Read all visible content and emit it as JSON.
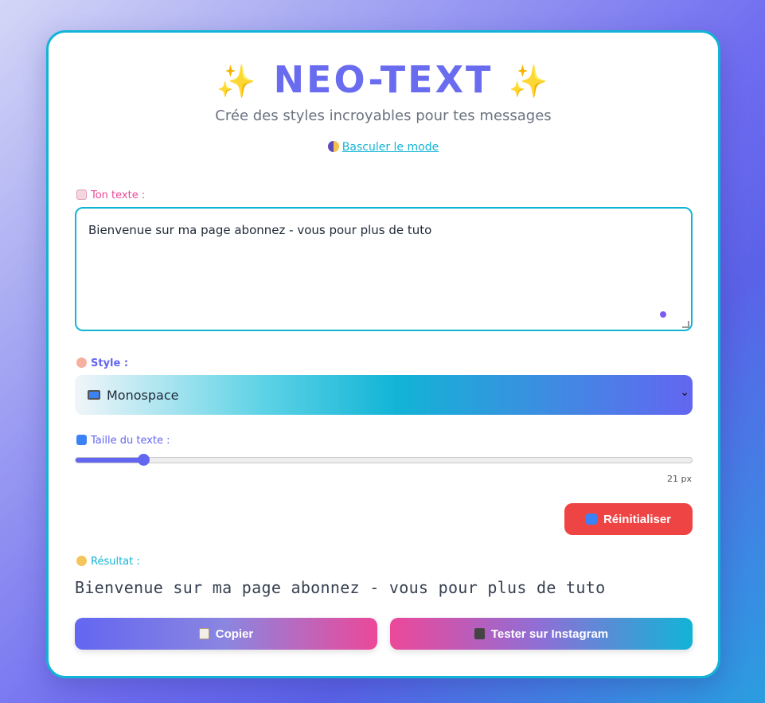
{
  "header": {
    "title": "NEO-TEXT",
    "subtitle": "Crée des styles incroyables pour tes messages",
    "mode_toggle": "Basculer le mode"
  },
  "text_field": {
    "label": "Ton texte :",
    "value": "Bienvenue sur ma page abonnez - vous pour plus de tuto"
  },
  "style_field": {
    "label": "Style :",
    "selected": "Monospace"
  },
  "size_field": {
    "label": "Taille du texte :",
    "value": "21 px",
    "fraction": 0.11
  },
  "reset_button": "Réinitialiser",
  "result": {
    "label": "Résultat :",
    "text": "Bienvenue sur ma page abonnez - vous pour plus de tuto"
  },
  "actions": {
    "copy": "Copier",
    "instagram": "Tester sur Instagram"
  },
  "colors": {
    "accent_indigo": "#6366f1",
    "accent_cyan": "#12b4d6",
    "accent_pink": "#ec4899",
    "danger": "#ef4444"
  }
}
